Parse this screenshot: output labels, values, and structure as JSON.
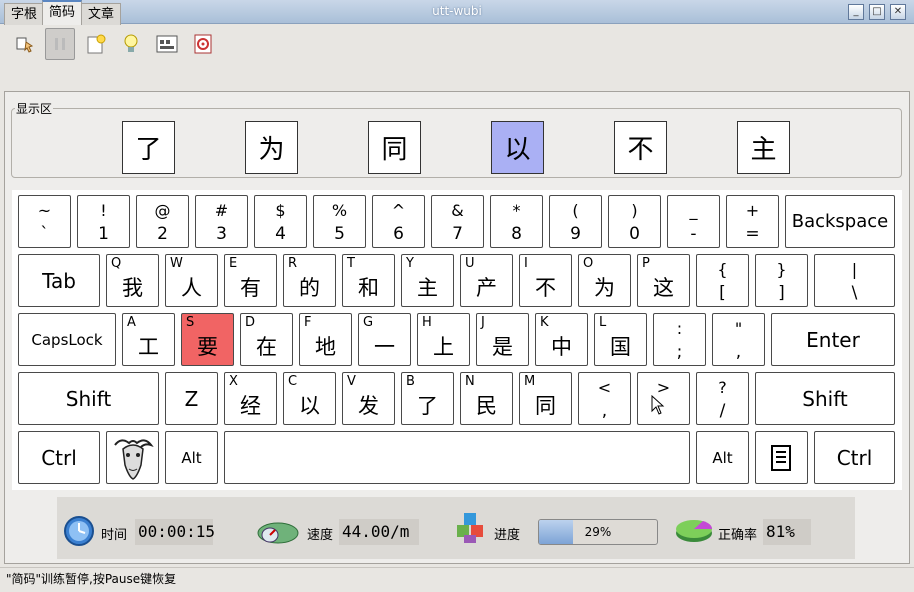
{
  "window": {
    "title": "utt-wubi"
  },
  "toolbar": {
    "icons": [
      "hand-pointer-icon",
      "pause-icon",
      "new-file-icon",
      "lightbulb-icon",
      "keyboard-icon",
      "target-icon"
    ]
  },
  "tabs": [
    {
      "label": "字根"
    },
    {
      "label": "简码"
    },
    {
      "label": "文章"
    }
  ],
  "active_tab": 1,
  "display": {
    "label": "显示区",
    "chars": [
      "了",
      "为",
      "同",
      "以",
      "不",
      "主"
    ],
    "highlight_index": 3
  },
  "keyboard": {
    "row1": [
      {
        "top": "~",
        "bottom": "`"
      },
      {
        "top": "!",
        "bottom": "1"
      },
      {
        "top": "@",
        "bottom": "2"
      },
      {
        "top": "#",
        "bottom": "3"
      },
      {
        "top": "$",
        "bottom": "4"
      },
      {
        "top": "%",
        "bottom": "5"
      },
      {
        "top": "^",
        "bottom": "6"
      },
      {
        "top": "&",
        "bottom": "7"
      },
      {
        "top": "*",
        "bottom": "8"
      },
      {
        "top": "(",
        "bottom": "9"
      },
      {
        "top": ")",
        "bottom": "0"
      },
      {
        "top": "_",
        "bottom": "-"
      },
      {
        "top": "+",
        "bottom": "="
      }
    ],
    "backspace": "Backspace",
    "tab": "Tab",
    "row2": [
      {
        "letter": "Q",
        "char": "我"
      },
      {
        "letter": "W",
        "char": "人"
      },
      {
        "letter": "E",
        "char": "有"
      },
      {
        "letter": "R",
        "char": "的"
      },
      {
        "letter": "T",
        "char": "和"
      },
      {
        "letter": "Y",
        "char": "主"
      },
      {
        "letter": "U",
        "char": "产"
      },
      {
        "letter": "I",
        "char": "不"
      },
      {
        "letter": "O",
        "char": "为"
      },
      {
        "letter": "P",
        "char": "这"
      }
    ],
    "row2_punct": [
      {
        "top": "{",
        "bottom": "["
      },
      {
        "top": "}",
        "bottom": "]"
      },
      {
        "top": "|",
        "bottom": "\\"
      }
    ],
    "capslock": "CapsLock",
    "row3": [
      {
        "letter": "A",
        "char": "工"
      },
      {
        "letter": "S",
        "char": "要"
      },
      {
        "letter": "D",
        "char": "在"
      },
      {
        "letter": "F",
        "char": "地"
      },
      {
        "letter": "G",
        "char": "一"
      },
      {
        "letter": "H",
        "char": "上"
      },
      {
        "letter": "J",
        "char": "是"
      },
      {
        "letter": "K",
        "char": "中"
      },
      {
        "letter": "L",
        "char": "国"
      }
    ],
    "row3_punct": [
      {
        "top": ":",
        "bottom": ";"
      },
      {
        "top": "\"",
        "bottom": ","
      }
    ],
    "enter": "Enter",
    "shift": "Shift",
    "z": "Z",
    "row4": [
      {
        "letter": "X",
        "char": "经"
      },
      {
        "letter": "C",
        "char": "以"
      },
      {
        "letter": "V",
        "char": "发"
      },
      {
        "letter": "B",
        "char": "了"
      },
      {
        "letter": "N",
        "char": "民"
      },
      {
        "letter": "M",
        "char": "同"
      }
    ],
    "row4_punct": [
      {
        "top": "<",
        "bottom": ","
      },
      {
        "top": ">",
        "bottom": ""
      },
      {
        "top": "?",
        "bottom": "/"
      }
    ],
    "ctrl": "Ctrl",
    "alt": "Alt",
    "highlight_key": "S",
    "highlight_color": "#f16464"
  },
  "stats": {
    "time": {
      "label": "时间",
      "value": "00:00:15"
    },
    "speed": {
      "label": "速度",
      "value": "44.00/m"
    },
    "progress": {
      "label": "进度",
      "value": "29%",
      "fraction": 0.29
    },
    "accuracy": {
      "label": "正确率",
      "value": "81%"
    }
  },
  "statusbar": "\"简码\"训练暂停,按Pause键恢复"
}
